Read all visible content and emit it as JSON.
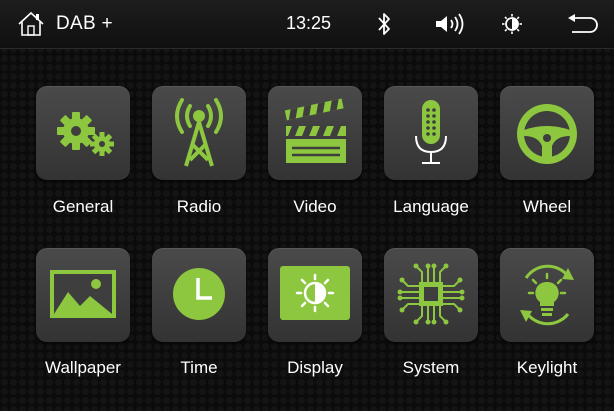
{
  "header": {
    "title": "DAB +",
    "time": "13:25",
    "icons": [
      "home-icon",
      "bluetooth-icon",
      "volume-icon",
      "brightness-icon",
      "back-icon"
    ]
  },
  "accent_color": "#8dc63f",
  "apps": [
    {
      "label": "General",
      "icon": "gears-icon"
    },
    {
      "label": "Radio",
      "icon": "radio-tower-icon"
    },
    {
      "label": "Video",
      "icon": "clapperboard-icon"
    },
    {
      "label": "Language",
      "icon": "microphone-icon"
    },
    {
      "label": "Wheel",
      "icon": "steering-wheel-icon"
    },
    {
      "label": "Wallpaper",
      "icon": "landscape-picture-icon"
    },
    {
      "label": "Time",
      "icon": "clock-icon"
    },
    {
      "label": "Display",
      "icon": "display-brightness-icon"
    },
    {
      "label": "System",
      "icon": "chip-icon"
    },
    {
      "label": "Keylight",
      "icon": "lightbulb-icon"
    }
  ]
}
